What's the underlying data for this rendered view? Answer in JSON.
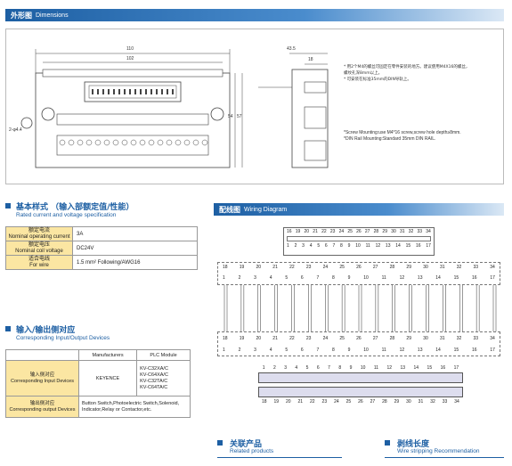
{
  "dimensions": {
    "header_cn": "外形图",
    "header_en": "Dimensions",
    "dim_110": "110",
    "dim_102": "102",
    "dim_hole": "2-φ4.4",
    "dim_57": "57",
    "dim_54": "54",
    "dim_435": "43.5",
    "dim_18": "18",
    "note_cn_1": "* 用2个M4的螺丝可固定在零件安装的地方。建议使用M4X16的螺丝，",
    "note_cn_2": "  螺纹孔深8mm以上。",
    "note_cn_3": "* 可安装在标准35mm的DIN导轨上。",
    "note_en_1": "*Screw Mounting:use M4*16 screw,screw hole depth≥8mm.",
    "note_en_2": "*DIN Rail Mounting:Standard 35mm DIN RAIL."
  },
  "spec": {
    "title_cn": "基本样式 （输入部额定值/性能）",
    "title_en": "Rated current and voltage specification",
    "rows": [
      {
        "cn": "额定电流",
        "en": "Nominal operating current",
        "value": "3A"
      },
      {
        "cn": "额定电压",
        "en": "Nominal coil voltage",
        "value": "DC24V"
      },
      {
        "cn": "适合电线",
        "en": "For wire",
        "value": "1.5 mm² Following/AWG16"
      }
    ]
  },
  "io": {
    "title_cn": "输入/输出侧对应",
    "title_en": "Corresponding Input/Output Devices",
    "col_manufacturers": "Manufacturers",
    "col_plc": "PLC Module",
    "in_cn": "输入侧对应",
    "in_en": "Corresponding Input Devices",
    "in_maker": "KEYENCE",
    "in_models": [
      "KV-C32XA/C",
      "KV-C64XA/C",
      "KV-C32TA/C",
      "KV-C64TA/C"
    ],
    "out_cn": "输出侧对应",
    "out_en": "Corresponding output Devices",
    "out_devices": "Button Switch,Photoelectric Switch,Solenoid, Indicator,Relay or Contactor,etc."
  },
  "wiring": {
    "header_cn": "配线图",
    "header_en": "Wiring Diagram",
    "top_pins_a": [
      "16",
      "19",
      "20",
      "21",
      "22",
      "23",
      "24",
      "25",
      "26",
      "27",
      "28",
      "29",
      "30",
      "31",
      "32",
      "33",
      "34"
    ],
    "top_pins_b": [
      "1",
      "2",
      "3",
      "4",
      "5",
      "6",
      "7",
      "8",
      "9",
      "10",
      "11",
      "12",
      "13",
      "14",
      "15",
      "16",
      "17"
    ],
    "row1_a": [
      "18",
      "19",
      "20",
      "21",
      "22",
      "23",
      "24",
      "25",
      "26",
      "27",
      "28",
      "29",
      "30",
      "31",
      "32",
      "33",
      "34"
    ],
    "row1_b": [
      "1",
      "2",
      "3",
      "4",
      "5",
      "6",
      "7",
      "8",
      "9",
      "10",
      "11",
      "12",
      "13",
      "14",
      "15",
      "16",
      "17"
    ]
  },
  "related": {
    "cn": "关联产品",
    "en": "Related products"
  },
  "strip": {
    "cn": "剥线长度",
    "en": "Wire stripping Recommendation"
  }
}
